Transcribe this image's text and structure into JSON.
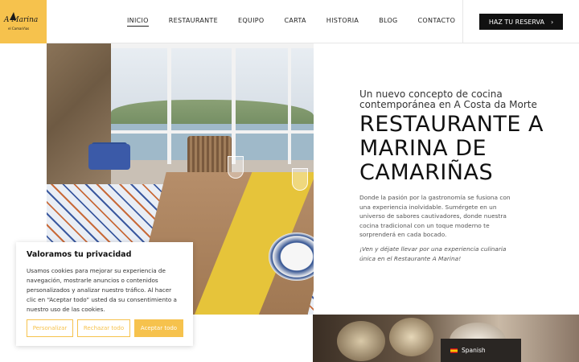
{
  "logo": {
    "name": "A Marina",
    "sub": "el Camariñas"
  },
  "nav": {
    "items": [
      "INICIO",
      "RESTAURANTE",
      "EQUIPO",
      "CARTA",
      "HISTORIA",
      "BLOG",
      "CONTACTO"
    ],
    "active": "INICIO"
  },
  "reserve_button": {
    "label": "HAZ TU RESERVA",
    "icon": "chevron-right-icon"
  },
  "hero": {
    "subtitle": "Un nuevo concepto de cocina contemporánea en A Costa da Morte",
    "title": "RESTAURANTE A MARINA DE CAMARIÑAS",
    "description": "Donde la pasión por la gastronomía se fusiona con una experiencia inolvidable. Sumérgete en un universo de sabores cautivadores, donde nuestra cocina tradicional con un toque moderno te sorprenderá en cada bocado.",
    "tagline": "¡Ven y déjate llevar por una experiencia culinaria única en el Restaurante A Marina!"
  },
  "cookie_banner": {
    "title": "Valoramos tu privacidad",
    "text": "Usamos cookies para mejorar su experiencia de navegación, mostrarle anuncios o contenidos personalizados y analizar nuestro tráfico. Al hacer clic en “Aceptar todo” usted da su consentimiento a nuestro uso de las cookies.",
    "buttons": {
      "customize": "Personalizar",
      "reject": "Rechazar todo",
      "accept": "Aceptar todo"
    }
  },
  "language": {
    "label": "Spanish",
    "flag": "spain-flag-icon"
  },
  "colors": {
    "brand_yellow": "#f6c24d",
    "dark": "#111111"
  }
}
